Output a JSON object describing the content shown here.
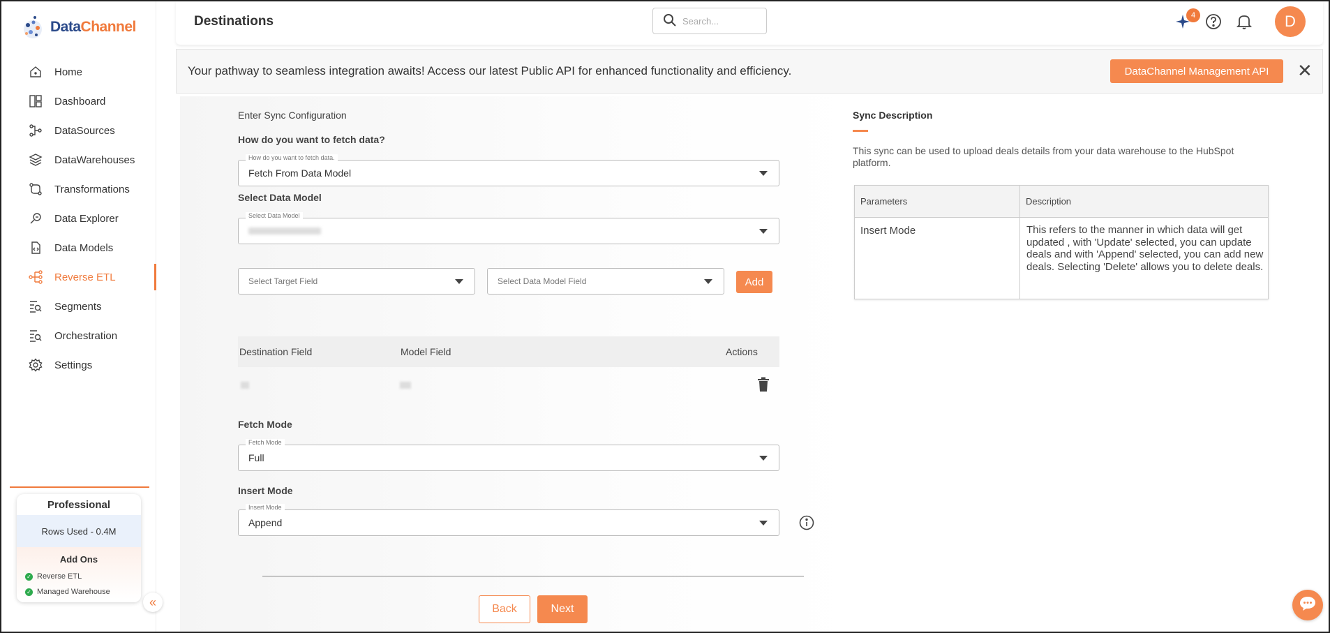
{
  "app": {
    "logo_text_a": "Data",
    "logo_text_b": "Channel"
  },
  "sidebar": {
    "items": [
      {
        "label": "Home",
        "icon": "home-icon"
      },
      {
        "label": "Dashboard",
        "icon": "dashboard-icon"
      },
      {
        "label": "DataSources",
        "icon": "datasources-icon"
      },
      {
        "label": "DataWarehouses",
        "icon": "datawarehouses-icon"
      },
      {
        "label": "Transformations",
        "icon": "transformations-icon"
      },
      {
        "label": "Data Explorer",
        "icon": "data-explorer-icon"
      },
      {
        "label": "Data Models",
        "icon": "data-models-icon"
      },
      {
        "label": "Reverse ETL",
        "icon": "reverse-etl-icon",
        "active": true
      },
      {
        "label": "Segments",
        "icon": "segments-icon"
      },
      {
        "label": "Orchestration",
        "icon": "orchestration-icon"
      },
      {
        "label": "Settings",
        "icon": "settings-icon"
      }
    ],
    "plan": {
      "title": "Professional",
      "rows_used": "Rows Used - 0.4M",
      "addons_title": "Add Ons",
      "addons": [
        "Reverse ETL",
        "Managed Warehouse"
      ]
    }
  },
  "header": {
    "title": "Destinations",
    "search_placeholder": "Search...",
    "notification_count": "4",
    "avatar_letter": "D"
  },
  "banner": {
    "text": "Your pathway to seamless integration awaits! Access our latest Public API for enhanced functionality and efficiency.",
    "button": "DataChannel Management API"
  },
  "form": {
    "section_title": "Enter Sync Configuration",
    "fetch_question": "How do you want to fetch data?",
    "fetch_floating": "How do you want to fetch data.",
    "fetch_value": "Fetch From Data Model",
    "data_model_label": "Select Data Model",
    "data_model_floating": "Select Data Model",
    "target_field_placeholder": "Select Target Field",
    "model_field_placeholder": "Select Data Model Field",
    "add_button": "Add",
    "table": {
      "headers": [
        "Destination Field",
        "Model Field",
        "Actions"
      ]
    },
    "fetch_mode_label": "Fetch Mode",
    "fetch_mode_floating": "Fetch Mode",
    "fetch_mode_value": "Full",
    "insert_mode_label": "Insert Mode",
    "insert_mode_floating": "Insert Mode",
    "insert_mode_value": "Append",
    "back_button": "Back",
    "next_button": "Next"
  },
  "sync_description": {
    "title": "Sync Description",
    "text": "This sync can be used to upload deals details from your data warehouse to the HubSpot platform.",
    "table": {
      "headers": [
        "Parameters",
        "Description"
      ],
      "row_param": "Insert Mode",
      "row_desc": "This refers to the manner in which data will get updated , with 'Update' selected, you can update deals and with 'Append' selected, you can add new deals. Selecting 'Delete' allows you to delete deals."
    }
  },
  "colors": {
    "accent": "#f5894f",
    "brand_blue": "#2b4a8a"
  }
}
